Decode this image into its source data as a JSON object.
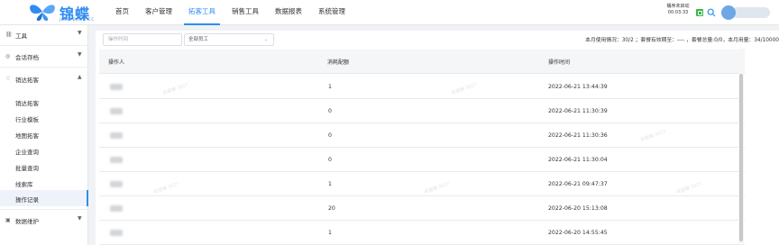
{
  "brand": {
    "name": "锦蝶",
    "sub": "JINDIEBAB.CC"
  },
  "nav": [
    {
      "label": "首页",
      "active": false
    },
    {
      "label": "客户管理",
      "active": false
    },
    {
      "label": "拓客工具",
      "active": true
    },
    {
      "label": "销售工具",
      "active": false
    },
    {
      "label": "数据报表",
      "active": false
    },
    {
      "label": "系统管理",
      "active": false
    }
  ],
  "status": {
    "line1": "桶序未启动",
    "line2": "00:03:33"
  },
  "sidebar": {
    "groups": [
      {
        "label": "工具",
        "icon": "link-icon"
      },
      {
        "label": "会话存档",
        "icon": "chat-icon"
      },
      {
        "label": "销达拓客",
        "icon": "heart-icon"
      },
      {
        "label": "数据维护",
        "icon": "database-icon"
      }
    ],
    "items": [
      {
        "label": "销达拓客"
      },
      {
        "label": "行业模板"
      },
      {
        "label": "地图拓客"
      },
      {
        "label": "企业查询"
      },
      {
        "label": "批量查询"
      },
      {
        "label": "线索库"
      },
      {
        "label": "操作记录",
        "active": true
      }
    ]
  },
  "filters": {
    "time_placeholder": "操作时间",
    "staff_select": "全部员工"
  },
  "usage_text": "本月使用情况：30/2 ；套餐有效期至：---- ，套餐总量:0/0，本月用量：34/10000",
  "table": {
    "headers": [
      "操作人",
      "消耗配额",
      "操作时间"
    ],
    "rows": [
      {
        "quota": "1",
        "time": "2022-06-21 13:44:39"
      },
      {
        "quota": "0",
        "time": "2022-06-21 11:30:39"
      },
      {
        "quota": "0",
        "time": "2022-06-21 11:30:36"
      },
      {
        "quota": "0",
        "time": "2022-06-21 11:30:04"
      },
      {
        "quota": "1",
        "time": "2022-06-21 09:47:37"
      },
      {
        "quota": "20",
        "time": "2022-06-20 15:13:08"
      },
      {
        "quota": "1",
        "time": "2022-06-20 14:55:45"
      }
    ]
  },
  "watermark": "拓客機 3027",
  "colors": {
    "accent": "#2f8cf0",
    "green": "#3bb54a"
  }
}
